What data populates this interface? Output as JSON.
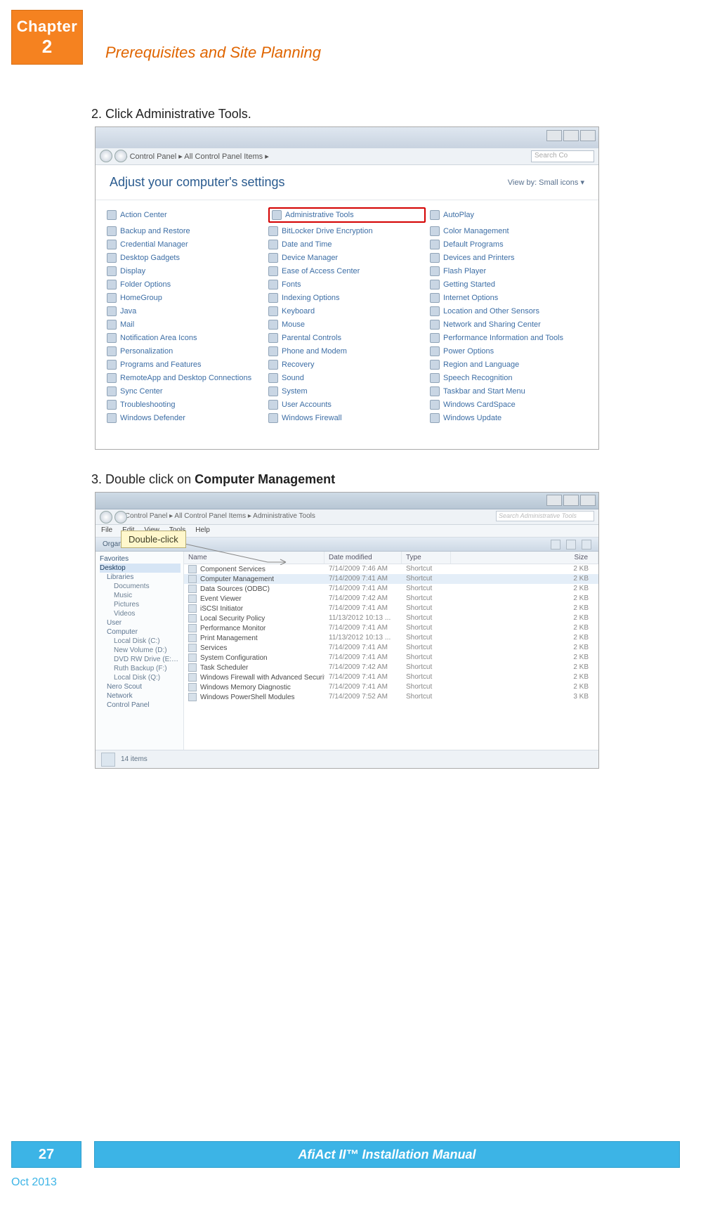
{
  "chapter": {
    "label": "Chapter",
    "number": "2"
  },
  "section_title": "Prerequisites and Site Planning",
  "steps": {
    "s2": "2.   Click Administrative Tools.",
    "s3_prefix": "3.   Double click on ",
    "s3_bold": "Computer Management"
  },
  "callout": "Double-click",
  "screenshot1": {
    "breadcrumb": "▸ Control Panel ▸ All Control Panel Items ▸",
    "search_placeholder": "Search Co",
    "header": "Adjust your computer's settings",
    "viewby": "View by:   Small icons ▾",
    "items": [
      [
        "Action Center",
        "Administrative Tools",
        "AutoPlay"
      ],
      [
        "Backup and Restore",
        "BitLocker Drive Encryption",
        "Color Management"
      ],
      [
        "Credential Manager",
        "Date and Time",
        "Default Programs"
      ],
      [
        "Desktop Gadgets",
        "Device Manager",
        "Devices and Printers"
      ],
      [
        "Display",
        "Ease of Access Center",
        "Flash Player"
      ],
      [
        "Folder Options",
        "Fonts",
        "Getting Started"
      ],
      [
        "HomeGroup",
        "Indexing Options",
        "Internet Options"
      ],
      [
        "Java",
        "Keyboard",
        "Location and Other Sensors"
      ],
      [
        "Mail",
        "Mouse",
        "Network and Sharing Center"
      ],
      [
        "Notification Area Icons",
        "Parental Controls",
        "Performance Information and Tools"
      ],
      [
        "Personalization",
        "Phone and Modem",
        "Power Options"
      ],
      [
        "Programs and Features",
        "Recovery",
        "Region and Language"
      ],
      [
        "RemoteApp and Desktop Connections",
        "Sound",
        "Speech Recognition"
      ],
      [
        "Sync Center",
        "System",
        "Taskbar and Start Menu"
      ],
      [
        "Troubleshooting",
        "User Accounts",
        "Windows CardSpace"
      ],
      [
        "Windows Defender",
        "Windows Firewall",
        "Windows Update"
      ]
    ],
    "highlight_row": 0,
    "highlight_col": 1
  },
  "screenshot2": {
    "breadcrumb": "▸ Control Panel ▸ All Control Panel Items ▸ Administrative Tools",
    "search_placeholder": "Search Administrative Tools",
    "menu": [
      "File",
      "Edit",
      "View",
      "Tools",
      "Help"
    ],
    "toolbar_left": "Organize ▾     Burn",
    "columns": [
      "Name",
      "Date modified",
      "Type",
      "Size"
    ],
    "tree": [
      {
        "t": "Favorites",
        "cls": ""
      },
      {
        "t": "Desktop",
        "cls": "sel"
      },
      {
        "t": "Libraries",
        "cls": "ind1"
      },
      {
        "t": "Documents",
        "cls": "ind2"
      },
      {
        "t": "Music",
        "cls": "ind2"
      },
      {
        "t": "Pictures",
        "cls": "ind2"
      },
      {
        "t": "Videos",
        "cls": "ind2"
      },
      {
        "t": "User",
        "cls": "ind1"
      },
      {
        "t": "Computer",
        "cls": "ind1"
      },
      {
        "t": "Local Disk (C:)",
        "cls": "ind2"
      },
      {
        "t": "New Volume (D:)",
        "cls": "ind2"
      },
      {
        "t": "DVD RW Drive (E:) New",
        "cls": "ind2"
      },
      {
        "t": "Ruth Backup (F:)",
        "cls": "ind2"
      },
      {
        "t": "Local Disk (Q:)",
        "cls": "ind2"
      },
      {
        "t": "Nero Scout",
        "cls": "ind1"
      },
      {
        "t": "Network",
        "cls": "ind1"
      },
      {
        "t": "Control Panel",
        "cls": "ind1"
      }
    ],
    "rows": [
      {
        "n": "Component Services",
        "d": "7/14/2009 7:46 AM",
        "t": "Shortcut",
        "s": "2 KB"
      },
      {
        "n": "Computer Management",
        "d": "7/14/2009 7:41 AM",
        "t": "Shortcut",
        "s": "2 KB",
        "sel": true
      },
      {
        "n": "Data Sources (ODBC)",
        "d": "7/14/2009 7:41 AM",
        "t": "Shortcut",
        "s": "2 KB"
      },
      {
        "n": "Event Viewer",
        "d": "7/14/2009 7:42 AM",
        "t": "Shortcut",
        "s": "2 KB"
      },
      {
        "n": "iSCSI Initiator",
        "d": "7/14/2009 7:41 AM",
        "t": "Shortcut",
        "s": "2 KB"
      },
      {
        "n": "Local Security Policy",
        "d": "11/13/2012 10:13 ...",
        "t": "Shortcut",
        "s": "2 KB"
      },
      {
        "n": "Performance Monitor",
        "d": "7/14/2009 7:41 AM",
        "t": "Shortcut",
        "s": "2 KB"
      },
      {
        "n": "Print Management",
        "d": "11/13/2012 10:13 ...",
        "t": "Shortcut",
        "s": "2 KB"
      },
      {
        "n": "Services",
        "d": "7/14/2009 7:41 AM",
        "t": "Shortcut",
        "s": "2 KB"
      },
      {
        "n": "System Configuration",
        "d": "7/14/2009 7:41 AM",
        "t": "Shortcut",
        "s": "2 KB"
      },
      {
        "n": "Task Scheduler",
        "d": "7/14/2009 7:42 AM",
        "t": "Shortcut",
        "s": "2 KB"
      },
      {
        "n": "Windows Firewall with Advanced Security",
        "d": "7/14/2009 7:41 AM",
        "t": "Shortcut",
        "s": "2 KB"
      },
      {
        "n": "Windows Memory Diagnostic",
        "d": "7/14/2009 7:41 AM",
        "t": "Shortcut",
        "s": "2 KB"
      },
      {
        "n": "Windows PowerShell Modules",
        "d": "7/14/2009 7:52 AM",
        "t": "Shortcut",
        "s": "3 KB"
      }
    ],
    "status": "14 items"
  },
  "footer": {
    "page": "27",
    "title": "AfiAct II™ Installation Manual",
    "date": "Oct 2013"
  }
}
